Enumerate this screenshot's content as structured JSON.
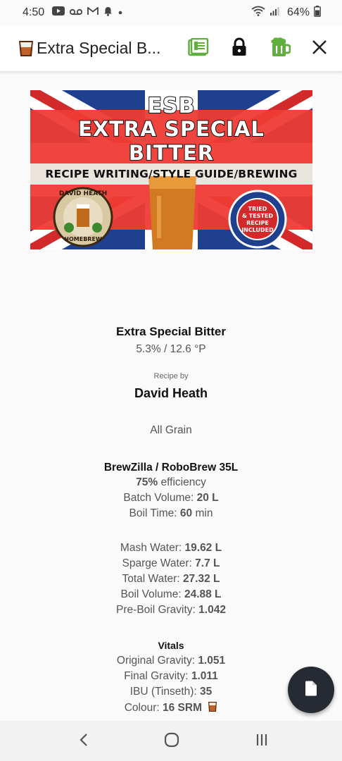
{
  "status_bar": {
    "time": "4:50",
    "battery": "64%",
    "icons": [
      "youtube-icon",
      "voicemail-icon",
      "gmail-icon",
      "notification-bell-icon",
      "dot-icon",
      "wifi-icon",
      "signal-icon",
      "battery-icon"
    ]
  },
  "app_bar": {
    "title": "Extra Special B...",
    "actions": [
      "brew-log-icon",
      "lock-icon",
      "beer-mug-icon",
      "close-icon"
    ]
  },
  "banner": {
    "line1": "ESB",
    "line2": "EXTRA SPECIAL",
    "line3": "BITTER",
    "strip": "RECIPE WRITING/STYLE GUIDE/BREWING",
    "logo_top": "DAVID HEATH",
    "logo_bottom": "HOMEBREW",
    "badge": [
      "TRIED",
      "& TESTED",
      "RECIPE",
      "INCLUDED"
    ]
  },
  "recipe": {
    "name": "Extra Special Bitter",
    "abv_og": "5.3% / 12.6 °P",
    "by_label": "Recipe by",
    "author": "David Heath",
    "type": "All Grain"
  },
  "equipment": {
    "name": "BrewZilla / RoboBrew 35L",
    "efficiency_value": "75%",
    "efficiency_label": " efficiency",
    "batch_label": "Batch Volume: ",
    "batch_value": "20 L",
    "boil_time_label": "Boil Time: ",
    "boil_time_value": "60",
    "boil_time_unit": " min"
  },
  "water": {
    "mash_label": "Mash Water: ",
    "mash_value": "19.62 L",
    "sparge_label": "Sparge Water: ",
    "sparge_value": "7.7 L",
    "total_label": "Total Water: ",
    "total_value": "27.32 L",
    "boil_vol_label": "Boil Volume: ",
    "boil_vol_value": "24.88 L",
    "preboil_label": "Pre-Boil Gravity: ",
    "preboil_value": "1.042"
  },
  "vitals": {
    "heading": "Vitals",
    "og_label": "Original Gravity: ",
    "og_value": "1.051",
    "fg_label": "Final Gravity: ",
    "fg_value": "1.011",
    "ibu_label": "IBU (Tinseth): ",
    "ibu_value": "35",
    "colour_label": "Colour: ",
    "colour_value": "16 SRM"
  },
  "colors": {
    "beer_amber": "#c1622a",
    "action_green": "#5fae3e",
    "fab_bg": "#262b33"
  }
}
